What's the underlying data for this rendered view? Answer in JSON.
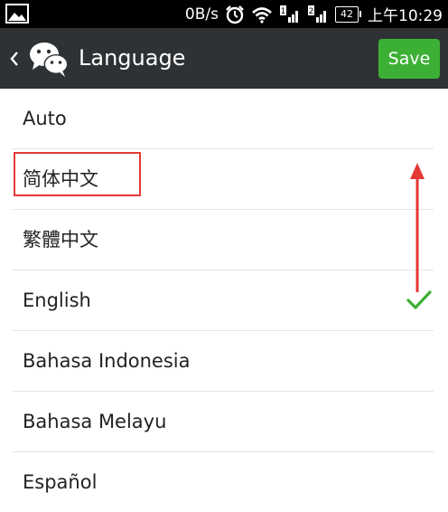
{
  "status_bar": {
    "net_speed": "0B/s",
    "sim1_label": "1",
    "sim2_label": "2",
    "battery": "42",
    "time": "上午10:29",
    "icons": [
      "image-icon",
      "alarm-icon",
      "wifi-icon",
      "signal-sim1-icon",
      "signal-sim2-icon",
      "battery-icon"
    ]
  },
  "action_bar": {
    "title": "Language",
    "save_label": "Save",
    "background": "#2f3234",
    "save_color": "#3cb034"
  },
  "languages": [
    {
      "label": "Auto",
      "selected": false
    },
    {
      "label": "简体中文",
      "selected": false
    },
    {
      "label": "繁體中文",
      "selected": false
    },
    {
      "label": "English",
      "selected": true
    },
    {
      "label": "Bahasa Indonesia",
      "selected": false
    },
    {
      "label": "Bahasa Melayu",
      "selected": false
    },
    {
      "label": "Español",
      "selected": false
    }
  ],
  "colors": {
    "check": "#3cb034",
    "annotation": "#e53935"
  }
}
